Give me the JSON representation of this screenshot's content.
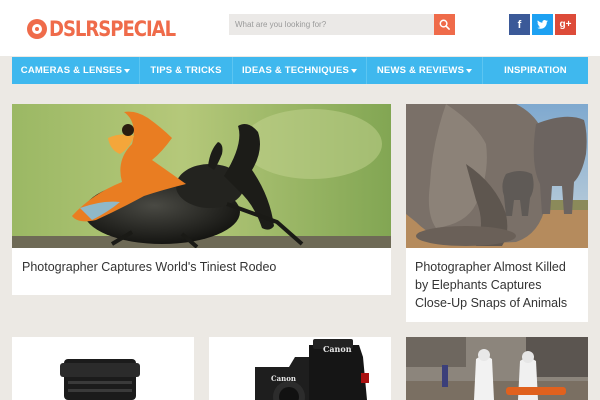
{
  "header": {
    "logo_text": "DSLRSPECIAL",
    "search_placeholder": "What are you looking for?"
  },
  "social": [
    {
      "name": "facebook",
      "glyph": "f",
      "color": "#3b5998"
    },
    {
      "name": "twitter",
      "glyph": "t",
      "color": "#1da1f2"
    },
    {
      "name": "google-plus",
      "glyph": "g+",
      "color": "#dd4b39"
    }
  ],
  "nav": {
    "items": [
      {
        "label": "CAMERAS & LENSES",
        "dropdown": true
      },
      {
        "label": "TIPS & TRICKS",
        "dropdown": false
      },
      {
        "label": "IDEAS & TECHNIQUES",
        "dropdown": true
      },
      {
        "label": "NEWS & REVIEWS",
        "dropdown": true
      },
      {
        "label": "INSPIRATION",
        "dropdown": false
      }
    ]
  },
  "articles": [
    {
      "title": "Photographer Captures World's Tiniest Rodeo"
    },
    {
      "title_lines": [
        "Photographer Almost Killed",
        "by Elephants Captures",
        "Close-Up Snaps of Animals"
      ]
    }
  ],
  "camera_brand": "Canon",
  "colors": {
    "accent": "#ef6b4a",
    "nav": "#3fb8ee",
    "background": "#ece9e4"
  }
}
